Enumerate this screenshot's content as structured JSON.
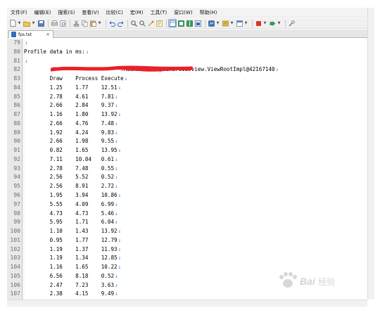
{
  "menu": [
    "文件(F)",
    "编辑(E)",
    "搜索(S)",
    "查看(V)",
    "比较(C)",
    "宏(M)",
    "工具(T)",
    "窗口(W)",
    "帮助(H)"
  ],
  "toolbar_icons": [
    "new-file-icon",
    "open-file-icon",
    "save-icon",
    "print-icon",
    "cut-icon",
    "copy-icon",
    "paste-icon",
    "undo-icon",
    "redo-icon",
    "find-icon",
    "replace-icon",
    "bookmark-icon",
    "view-icon",
    "macro-record-icon",
    "run-icon"
  ],
  "tab": {
    "label": "fps.txt",
    "close": "×"
  },
  "editor": {
    "eol_mark": "↓",
    "lines": [
      {
        "n": "79",
        "text": ""
      },
      {
        "n": "80",
        "text": "Profile data in ms:"
      },
      {
        "n": "81",
        "text": ""
      },
      {
        "n": "82",
        "text": "                              .MainActivity/android.view.ViewRootImpl@42167140"
      },
      {
        "n": "83",
        "text": "        Draw    Process Execute"
      },
      {
        "n": "84",
        "text": "        1.25    1.77    12.51"
      },
      {
        "n": "85",
        "text": "        2.78    4.61    7.81"
      },
      {
        "n": "86",
        "text": "        2.66    2.84    9.37"
      },
      {
        "n": "87",
        "text": "        1.16    1.80    13.92"
      },
      {
        "n": "88",
        "text": "        2.66    4.76    7.48"
      },
      {
        "n": "89",
        "text": "        1.92    4.24    9.83"
      },
      {
        "n": "90",
        "text": "        2.66    1.98    9.55"
      },
      {
        "n": "91",
        "text": "        0.82    1.65    13.95"
      },
      {
        "n": "92",
        "text": "        7.11    10.04   0.61"
      },
      {
        "n": "93",
        "text": "        2.78    7.48    0.55"
      },
      {
        "n": "94",
        "text": "        2.56    5.52    0.52"
      },
      {
        "n": "95",
        "text": "        2.56    8.91    2.72"
      },
      {
        "n": "96",
        "text": "        1.95    3.94    10.86"
      },
      {
        "n": "97",
        "text": "        5.55    4.09    6.99"
      },
      {
        "n": "98",
        "text": "        4.73    4.73    5.46"
      },
      {
        "n": "99",
        "text": "        5.95    1.71    6.04"
      },
      {
        "n": "100",
        "text": "        1.10    1.43    13.92"
      },
      {
        "n": "101",
        "text": "        0.95    1.77    12.79"
      },
      {
        "n": "102",
        "text": "        1.19    1.37    11.93"
      },
      {
        "n": "103",
        "text": "        1.19    1.34    12.85"
      },
      {
        "n": "104",
        "text": "        1.16    1.65    10.22"
      },
      {
        "n": "105",
        "text": "        6.56    8.18    0.52"
      },
      {
        "n": "106",
        "text": "        2.47    7.23    3.63"
      },
      {
        "n": "107",
        "text": "        2.38    4.15    9.49"
      }
    ]
  },
  "watermark": {
    "text": "Baidu 经验"
  },
  "colors": {
    "redaction": "#e8212a",
    "eol": "#3b8ede",
    "gutter": "#e9e9e9"
  }
}
